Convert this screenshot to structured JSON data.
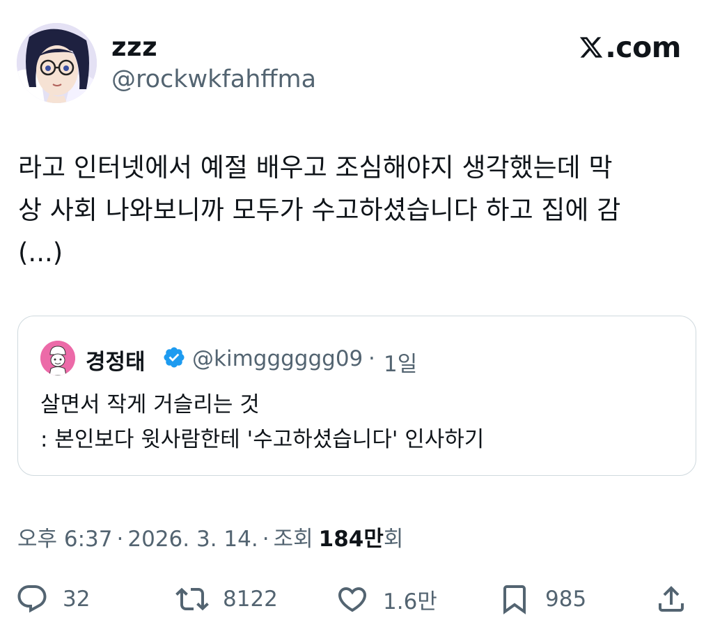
{
  "author": {
    "display_name": "zzz",
    "handle": "@rockwkfahffma"
  },
  "brand": {
    "label": ".com",
    "icon": "x-logo-icon"
  },
  "tweet": {
    "text": "라고 인터넷에서 예절 배우고 조심해야지 생각했는데 막\n상 사회 나와보니까 모두가 수고하셨습니다 하고 집에 감\n(...)"
  },
  "quote": {
    "display_name": "경정태",
    "verified_icon": "verified-badge-icon",
    "handle": "@kimgggggg09",
    "separator": "·",
    "time": "1일",
    "text": "살면서 작게 거슬리는 것\n: 본인보다 윗사람한테 '수고하셨습니다' 인사하기"
  },
  "meta": {
    "time": "오후 6:37",
    "sep1": "·",
    "date": "2026. 3. 14.",
    "sep2": "·",
    "views_label": "조회",
    "views_number": "184만",
    "views_suffix": "회"
  },
  "actions": {
    "reply_count": "32",
    "retweet_count": "8122",
    "like_count": "1.6만",
    "bookmark_count": "985"
  },
  "colors": {
    "text": "#0f1419",
    "secondary": "#536471",
    "border": "#cfd9de",
    "verified": "#1d9bf0"
  }
}
